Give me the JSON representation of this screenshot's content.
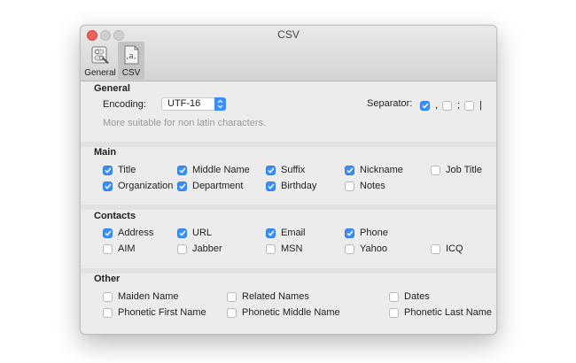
{
  "window": {
    "title": "CSV"
  },
  "tabs": [
    {
      "label": "General",
      "icon": "general-switch-icon"
    },
    {
      "label": "CSV",
      "icon": "csv-document-icon"
    }
  ],
  "general": {
    "heading": "General",
    "encoding_label": "Encoding:",
    "encoding_value": "UTF-16",
    "encoding_hint": "More suitable for non latin characters.",
    "separator_label": "Separator:",
    "separators": [
      {
        "label": ",",
        "checked": true
      },
      {
        "label": ";",
        "checked": false
      },
      {
        "label": "|",
        "checked": false
      }
    ]
  },
  "main": {
    "heading": "Main",
    "items": [
      {
        "label": "Title",
        "checked": true
      },
      {
        "label": "Middle Name",
        "checked": true
      },
      {
        "label": "Suffix",
        "checked": true
      },
      {
        "label": "Nickname",
        "checked": true
      },
      {
        "label": "Job Title",
        "checked": false
      },
      {
        "label": "Organization",
        "checked": true
      },
      {
        "label": "Department",
        "checked": true
      },
      {
        "label": "Birthday",
        "checked": true
      },
      {
        "label": "Notes",
        "checked": false
      }
    ]
  },
  "contacts": {
    "heading": "Contacts",
    "items": [
      {
        "label": "Address",
        "checked": true
      },
      {
        "label": "URL",
        "checked": true
      },
      {
        "label": "Email",
        "checked": true
      },
      {
        "label": "Phone",
        "checked": true
      },
      {
        "label": "AIM",
        "checked": false
      },
      {
        "label": "Jabber",
        "checked": false
      },
      {
        "label": "MSN",
        "checked": false
      },
      {
        "label": "Yahoo",
        "checked": false
      },
      {
        "label": "ICQ",
        "checked": false
      }
    ]
  },
  "other": {
    "heading": "Other",
    "items": [
      {
        "label": "Maiden Name",
        "checked": false
      },
      {
        "label": "Related Names",
        "checked": false
      },
      {
        "label": "Dates",
        "checked": false
      },
      {
        "label": "Phonetic First Name",
        "checked": false
      },
      {
        "label": "Phonetic Middle Name",
        "checked": false
      },
      {
        "label": "Phonetic Last Name",
        "checked": false
      }
    ]
  },
  "colors": {
    "accent": "#3b8ef6",
    "close": "#ed5f57"
  }
}
